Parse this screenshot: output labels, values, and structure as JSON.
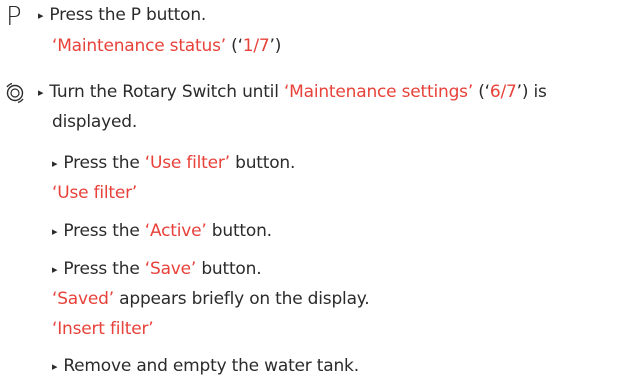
{
  "icons": {
    "p_button": "P",
    "rotary": "rotary-switch-icon"
  },
  "colors": {
    "text": "#2b2b2b",
    "display": "#e8413a"
  },
  "steps": {
    "s1": {
      "bullet": "▸",
      "text": "Press the P button."
    },
    "d1": {
      "a": "‘Maintenance status’",
      "b": " (‘",
      "c": "1/7",
      "d": "’)"
    },
    "s2": {
      "bullet": "▸",
      "pre": "Turn the Rotary Switch until ",
      "hl": "‘Maintenance settings’",
      "b": " (‘",
      "c": "6/7",
      "d": "’) is"
    },
    "s2b": "displayed.",
    "s3": {
      "bullet": "▸",
      "pre": "Press the ",
      "hl": "‘Use filter’",
      "post": " button."
    },
    "d3": "‘Use filter’",
    "s4": {
      "bullet": "▸",
      "pre": "Press the ",
      "hl": "‘Active’",
      "post": " button."
    },
    "s5": {
      "bullet": "▸",
      "pre": "Press the ",
      "hl": "‘Save’",
      "post": " button."
    },
    "d5a": {
      "hl": "‘Saved’",
      "post": " appears briefly on the display."
    },
    "d5b": "‘Insert filter’",
    "s6": {
      "bullet": "▸",
      "text": "Remove and empty the water tank."
    }
  }
}
